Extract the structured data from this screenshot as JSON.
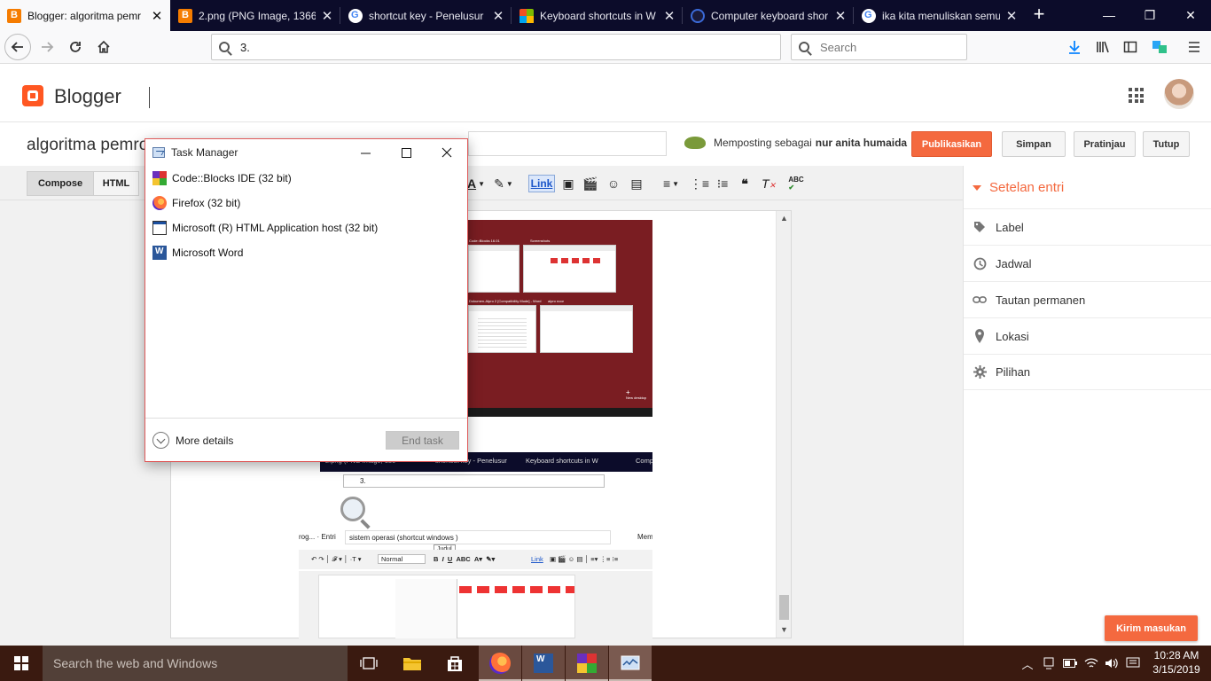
{
  "browser": {
    "tabs": [
      {
        "title": "Blogger: algoritma pemr",
        "favicon": "blogger-icon",
        "active": true
      },
      {
        "title": "2.png (PNG Image, 1366",
        "favicon": "blogger-icon",
        "active": false
      },
      {
        "title": "shortcut key - Penelusur",
        "favicon": "google-icon",
        "active": false
      },
      {
        "title": "Keyboard shortcuts in W",
        "favicon": "microsoft-icon",
        "active": false
      },
      {
        "title": "Computer keyboard shor",
        "favicon": "computer-icon",
        "active": false
      },
      {
        "title": "ika kita menuliskan semu",
        "favicon": "google-icon",
        "active": false
      }
    ],
    "url": "3.",
    "search_placeholder": "Search"
  },
  "blogger": {
    "brand": "Blogger",
    "post_title": "algoritma pemro",
    "posting_as_prefix": "Memposting sebagai",
    "posting_as_user": "nur anita humaida",
    "buttons": {
      "publish": "Publikasikan",
      "save": "Simpan",
      "preview": "Pratinjau",
      "close": "Tutup"
    },
    "modes": {
      "compose": "Compose",
      "html": "HTML"
    },
    "toolbar_link": "Link",
    "sidebar": {
      "heading": "Setelan entri",
      "items": [
        {
          "label": "Label",
          "icon": "tag-icon"
        },
        {
          "label": "Jadwal",
          "icon": "clock-icon"
        },
        {
          "label": "Tautan permanen",
          "icon": "link-icon"
        },
        {
          "label": "Lokasi",
          "icon": "location-pin-icon"
        },
        {
          "label": "Pilihan",
          "icon": "gear-icon"
        }
      ]
    },
    "feedback": "Kirim masukan"
  },
  "embedded_screenshot": {
    "window_labels": [
      "Code::Blocks 16.01",
      "Screenshots",
      "Dokumen-Alpro 2 [Compatibility Mode] - Word",
      "alpro noor"
    ],
    "new_desktop": "New desktop",
    "tabs": [
      "2.png (PNG Image, 136",
      "shortcut key - Penelusur",
      "Keyboard shortcuts in W",
      "Comp"
    ],
    "url": "3.",
    "title_partial": "rog... · Entri",
    "post_title": "sistem operasi (shortcut windows )",
    "tooltip": "Judul",
    "normal": "Normal",
    "link": "Link",
    "posting": "Mem"
  },
  "task_manager": {
    "title": "Task Manager",
    "apps": [
      {
        "name": "Code::Blocks IDE (32 bit)",
        "icon": "codeblocks-icon"
      },
      {
        "name": "Firefox (32 bit)",
        "icon": "firefox-icon"
      },
      {
        "name": "Microsoft (R) HTML Application host (32 bit)",
        "icon": "hta-icon"
      },
      {
        "name": "Microsoft Word",
        "icon": "word-icon"
      }
    ],
    "more_details": "More details",
    "end_task": "End task"
  },
  "taskbar": {
    "search_placeholder": "Search the web and Windows",
    "time": "10:28 AM",
    "date": "3/15/2019"
  }
}
